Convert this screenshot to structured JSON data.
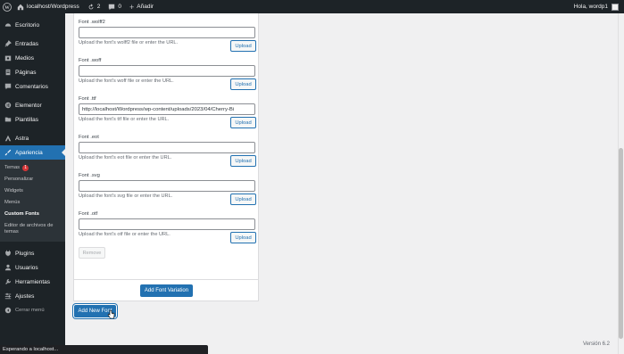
{
  "adminbar": {
    "site_name": "localhost/Wordpress",
    "updates_count": "2",
    "comments_count": "0",
    "new_label": "Añadir",
    "greeting": "Hola, wordp1"
  },
  "sidebar": {
    "items_top": [
      {
        "label": "Escritorio",
        "icon": "dashboard-icon"
      },
      {
        "label": "Entradas",
        "icon": "pin-icon"
      },
      {
        "label": "Medios",
        "icon": "media-icon"
      },
      {
        "label": "Páginas",
        "icon": "page-icon"
      },
      {
        "label": "Comentarios",
        "icon": "comment-icon"
      },
      {
        "label": "Elementor",
        "icon": "elementor-icon"
      },
      {
        "label": "Plantillas",
        "icon": "folder-icon"
      },
      {
        "label": "Astra",
        "icon": "astra-icon"
      },
      {
        "label": "Apariencia",
        "icon": "brush-icon"
      }
    ],
    "submenu": {
      "temas": "Temas",
      "temas_badge": "1",
      "personalizar": "Personalizar",
      "widgets": "Widgets",
      "menus": "Menús",
      "custom_fonts": "Custom Fonts",
      "editor": "Editor de archivos de temas"
    },
    "items_bottom": [
      {
        "label": "Plugins",
        "icon": "plugin-icon"
      },
      {
        "label": "Usuarios",
        "icon": "users-icon"
      },
      {
        "label": "Herramientas",
        "icon": "tools-icon"
      },
      {
        "label": "Ajustes",
        "icon": "settings-icon"
      },
      {
        "label": "Cerrar menú",
        "icon": "collapse-icon"
      }
    ]
  },
  "fields": [
    {
      "label": "Font .wolff2",
      "value": "",
      "desc": "Upload the font's wolff2 file or enter the URL.",
      "button": "Upload"
    },
    {
      "label": "Font .woff",
      "value": "",
      "desc": "Upload the font's woff file or enter the URL.",
      "button": "Upload"
    },
    {
      "label": "Font .ttf",
      "value": "http://localhost/Wordpress/wp-content/uploads/2023/04/Cherry-Bi",
      "desc": "Upload the font's ttf file or enter the URL.",
      "button": "Upload"
    },
    {
      "label": "Font .eot",
      "value": "",
      "desc": "Upload the font's eot file or enter the URL.",
      "button": "Upload"
    },
    {
      "label": "Font .svg",
      "value": "",
      "desc": "Upload the font's svg file or enter the URL.",
      "button": "Upload"
    },
    {
      "label": "Font .otf",
      "value": "",
      "desc": "Upload the font's otf file or enter the URL.",
      "button": "Upload"
    }
  ],
  "remove_label": "Remove",
  "add_variation_label": "Add Font Variation",
  "add_new_font_label": "Add New Font",
  "version": "Versión 6.2",
  "status_text": "Esperando a localhost...",
  "colors": {
    "accent": "#2271b1",
    "sidebar_bg": "#1d2327",
    "badge": "#d63638"
  }
}
